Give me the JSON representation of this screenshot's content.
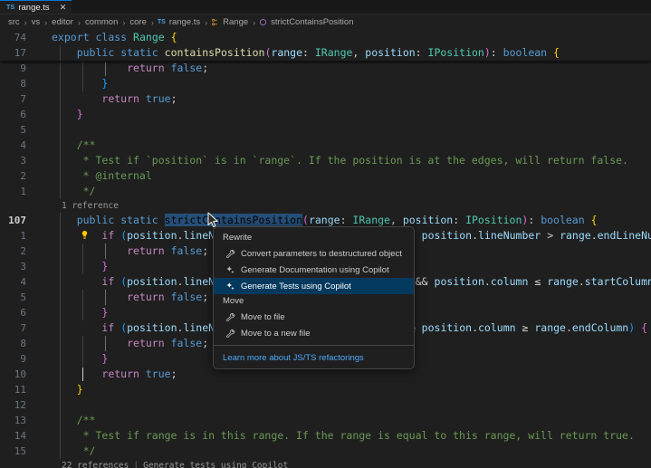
{
  "tab": {
    "icon": "typescript-file-icon",
    "icon_label": "TS",
    "filename": "range.ts",
    "close_label": "✕"
  },
  "breadcrumb": {
    "sep": "›",
    "items": [
      {
        "label": "src",
        "icon": ""
      },
      {
        "label": "vs",
        "icon": ""
      },
      {
        "label": "editor",
        "icon": ""
      },
      {
        "label": "common",
        "icon": ""
      },
      {
        "label": "core",
        "icon": ""
      },
      {
        "label": "range.ts",
        "icon": "typescript-file-icon",
        "icon_label": "TS"
      },
      {
        "label": "Range",
        "icon": "class-symbol-icon",
        "icon_label": "☲"
      },
      {
        "label": "strictContainsPosition",
        "icon": "method-symbol-icon",
        "icon_label": "⬡"
      }
    ]
  },
  "sticky": {
    "lines": [
      {
        "num": "74",
        "text": "export class Range {"
      },
      {
        "num": "17",
        "text": "    public static containsPosition(range: IRange, position: IPosition): boolean {"
      }
    ]
  },
  "code": {
    "lines": [
      {
        "num": "9",
        "text": "            return false;"
      },
      {
        "num": "8",
        "text": "        }"
      },
      {
        "num": "7",
        "text": "        return true;"
      },
      {
        "num": "6",
        "text": "    }"
      },
      {
        "num": "5",
        "text": ""
      },
      {
        "num": "4",
        "text": "    /**"
      },
      {
        "num": "3",
        "text": "     * Test if `position` is in `range`. If the position is at the edges, will return false."
      },
      {
        "num": "2",
        "text": "     * @internal"
      },
      {
        "num": "1",
        "text": "     */"
      },
      {
        "num": "107",
        "text": "    public static strictContainsPosition(range: IRange, position: IPosition): boolean {",
        "current": true,
        "bulb": true
      },
      {
        "num": "1",
        "text": "        if (position.lineNumber < range.startLineNumber || position.lineNumber > range.endLineNumber) {"
      },
      {
        "num": "2",
        "text": "            return false;"
      },
      {
        "num": "3",
        "text": "        }"
      },
      {
        "num": "4",
        "text": "        if (position.lineNumber === range.startLineNumber && position.column <= range.startColumn) {"
      },
      {
        "num": "5",
        "text": "            return false;"
      },
      {
        "num": "6",
        "text": "        }"
      },
      {
        "num": "7",
        "text": "        if (position.lineNumber === range.endLineNumber && position.column >= range.endColumn) {"
      },
      {
        "num": "8",
        "text": "            return false;"
      },
      {
        "num": "9",
        "text": "        }"
      },
      {
        "num": "10",
        "text": "        return true;"
      },
      {
        "num": "11",
        "text": "    }"
      },
      {
        "num": "12",
        "text": ""
      },
      {
        "num": "13",
        "text": "    /**"
      },
      {
        "num": "14",
        "text": "     * Test if range is in this range. If the range is equal to this range, will return true."
      },
      {
        "num": "15",
        "text": "     */"
      }
    ]
  },
  "codelens": {
    "top": "1 reference",
    "bottom_refs": "22 references",
    "bottom_sep": "|",
    "bottom_action": "Generate tests using Copilot"
  },
  "selection": {
    "text": "strictContainsPosition"
  },
  "context_menu": {
    "groups": [
      {
        "title": "Rewrite",
        "items": [
          {
            "label": "Convert parameters to destructured object",
            "icon": "wrench-icon",
            "active": false
          },
          {
            "label": "Generate Documentation using Copilot",
            "icon": "sparkle-icon",
            "active": false
          },
          {
            "label": "Generate Tests using Copilot",
            "icon": "sparkle-icon",
            "active": true
          }
        ]
      },
      {
        "title": "Move",
        "items": [
          {
            "label": "Move to file",
            "icon": "wrench-icon",
            "active": false
          },
          {
            "label": "Move to a new file",
            "icon": "wrench-icon",
            "active": false
          }
        ]
      }
    ],
    "footer_link": "Learn more about JS/TS refactorings"
  },
  "colors": {
    "editor_bg": "#1f1f1f",
    "tabbar_bg": "#181818",
    "accent": "#0078d4",
    "menu_active": "#04395e",
    "link": "#4daafc",
    "selection": "#264f78",
    "lightbulb": "#ffcc00"
  }
}
